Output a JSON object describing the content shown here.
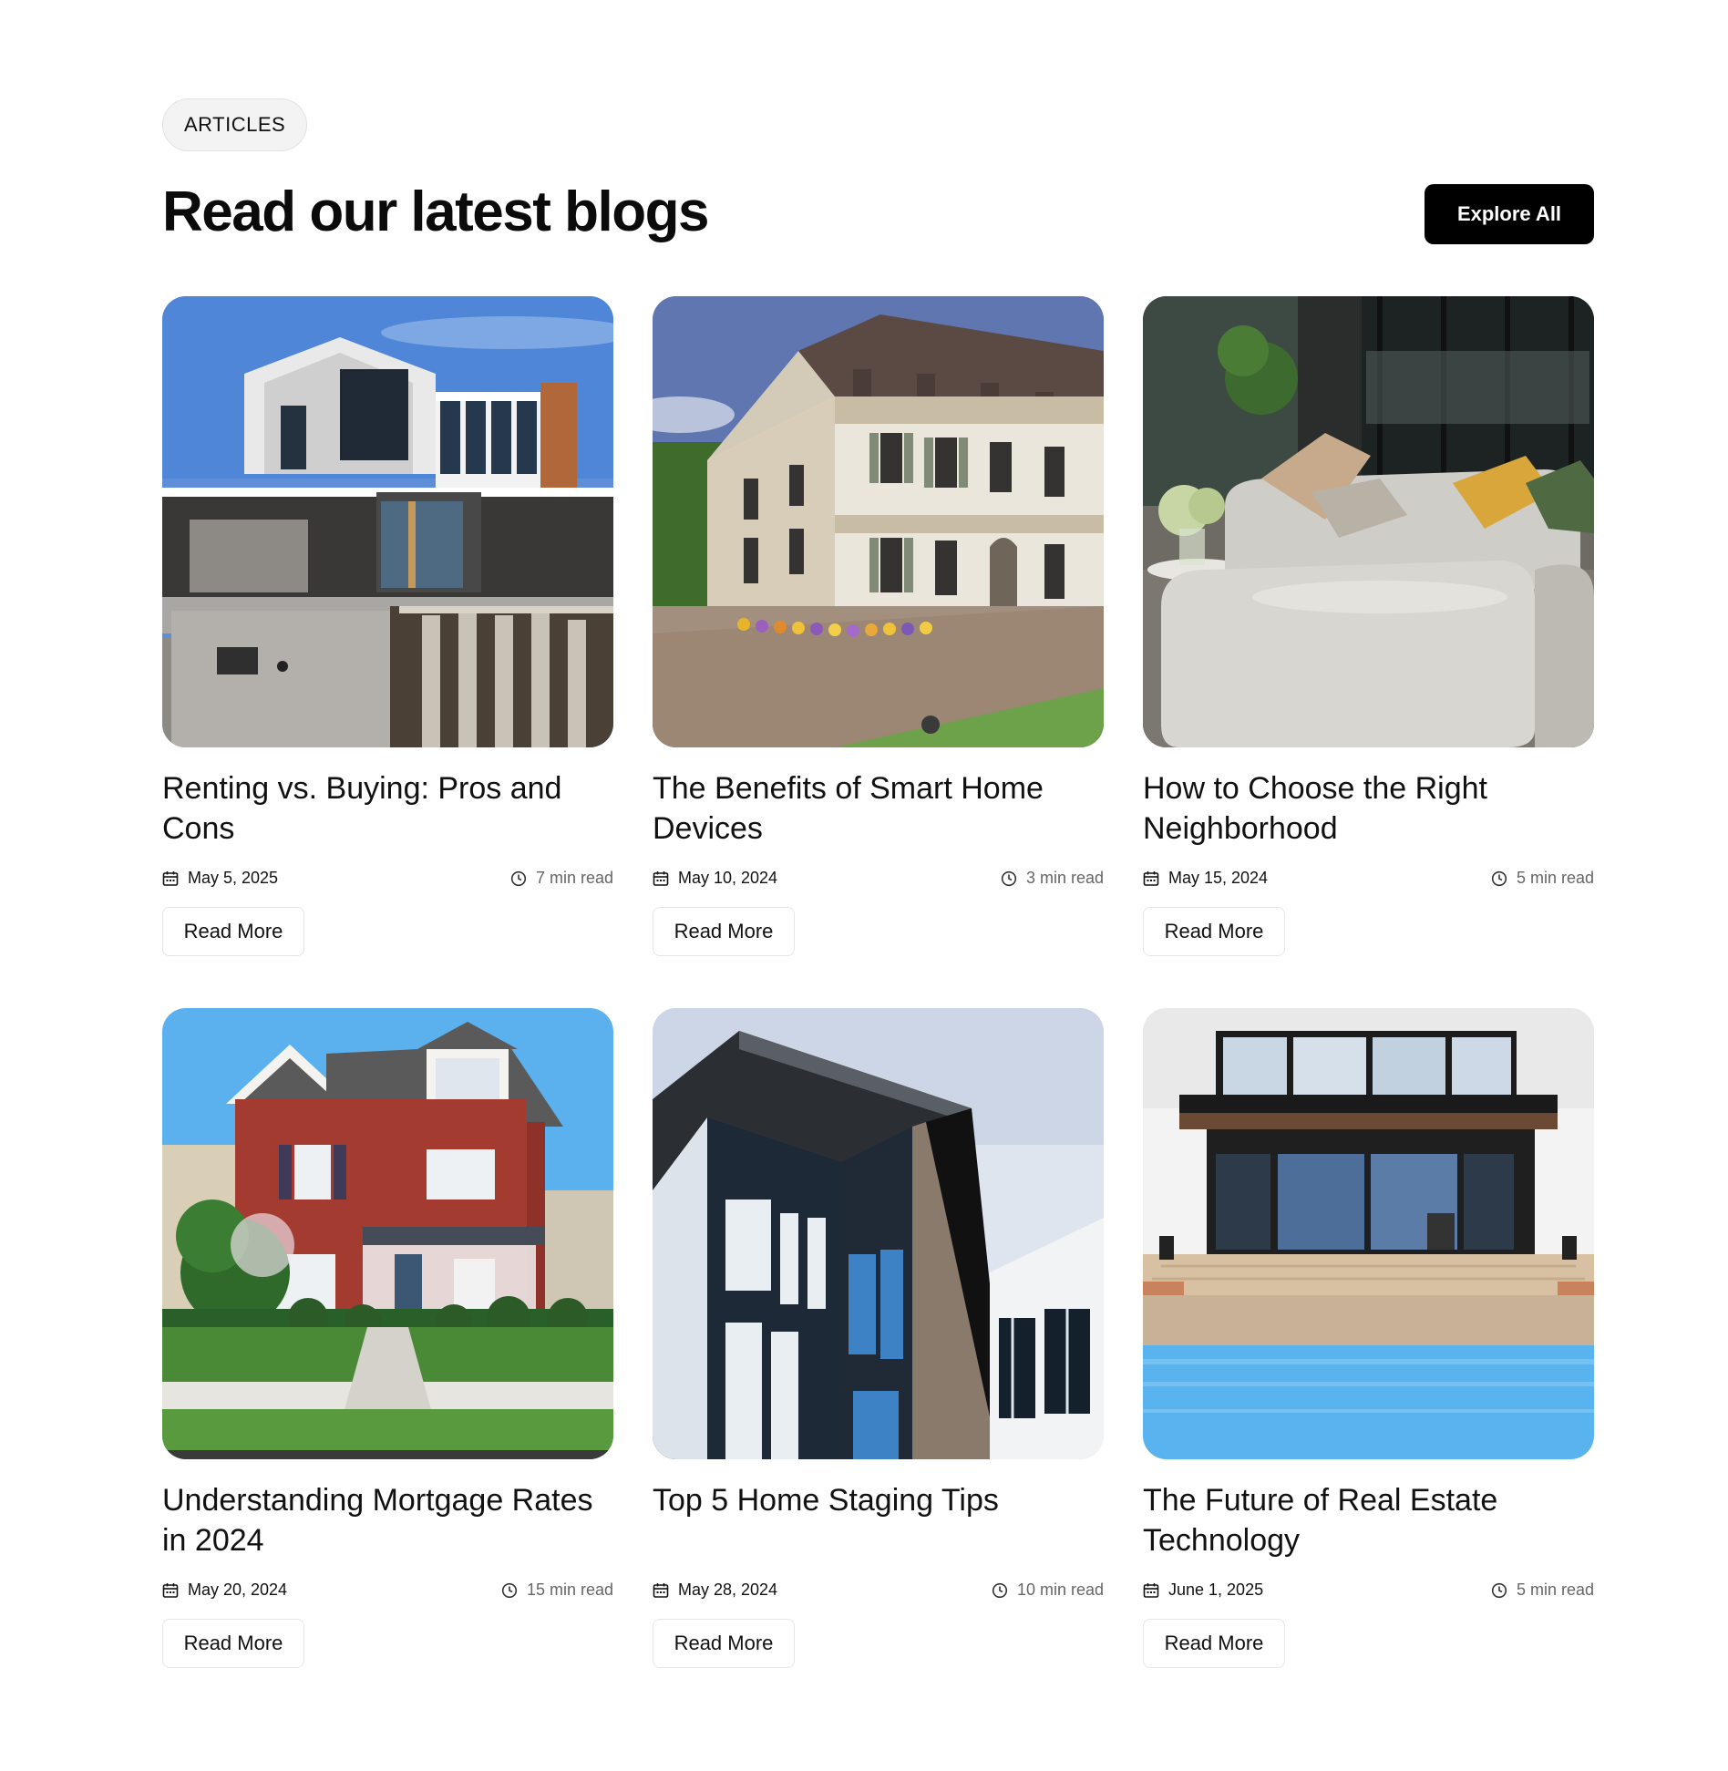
{
  "section": {
    "badge": "ARTICLES",
    "title": "Read our latest blogs",
    "explore_label": "Explore All"
  },
  "read_more_label": "Read More",
  "posts": [
    {
      "title": "Renting vs. Buying: Pros and Cons",
      "date": "May 5, 2025",
      "read_time": "7 min read",
      "image": "modern-house-photo"
    },
    {
      "title": "The Benefits of Smart Home Devices",
      "date": "May 10, 2024",
      "read_time": "3 min read",
      "image": "manor-house-photo"
    },
    {
      "title": "How to Choose the Right Neighborhood",
      "date": "May 15, 2024",
      "read_time": "5 min read",
      "image": "living-room-sofa-photo"
    },
    {
      "title": "Understanding Mortgage Rates in 2024",
      "date": "May 20, 2024",
      "read_time": "15 min read",
      "image": "red-house-photo"
    },
    {
      "title": "Top 5 Home Staging Tips",
      "date": "May 28, 2024",
      "read_time": "10 min read",
      "image": "dark-building-photo"
    },
    {
      "title": "The Future of Real Estate Technology",
      "date": "June 1, 2025",
      "read_time": "5 min read",
      "image": "pool-villa-photo"
    }
  ],
  "icons": {
    "date": "calendar-icon",
    "read_time": "clock-icon"
  },
  "colors": {
    "primary_button": "#000000",
    "badge_bg": "#f3f3f3",
    "muted_text": "#666666"
  }
}
